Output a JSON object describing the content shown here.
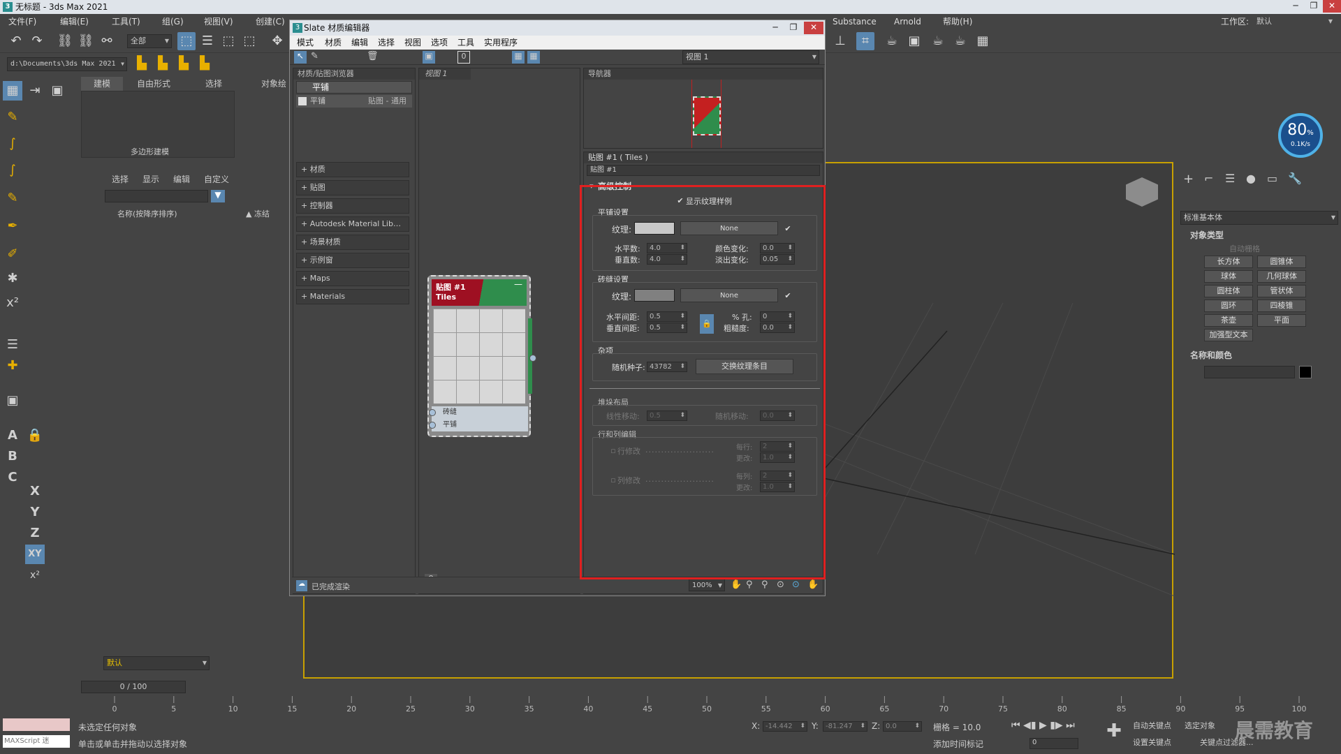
{
  "app": {
    "title": "无标题 - 3ds Max 2021",
    "title_icon": "3"
  },
  "menubar": {
    "items_left": [
      "文件(F)",
      "编辑(E)",
      "工具(T)",
      "组(G)",
      "视图(V)",
      "创建(C)"
    ],
    "items_right": [
      "Substance",
      "Arnold",
      "帮助(H)"
    ],
    "workspace_label": "工作区:",
    "workspace_value": "默认"
  },
  "toolbar": {
    "selection_filter": "全部",
    "path": "d:\\Documents\\3ds Max 2021"
  },
  "ribbon": {
    "tabs": [
      "建模",
      "自由形式",
      "选择",
      "对象绘"
    ],
    "group_label": "多边形建模"
  },
  "scene_explorer": {
    "menu": [
      "选择",
      "显示",
      "编辑",
      "自定义"
    ],
    "column_name": "名称(按降序排序)",
    "column_frozen": "▲ 冻结",
    "layer_label": "默认"
  },
  "slate": {
    "title": "Slate 材质编辑器",
    "menu": [
      "模式",
      "材质",
      "编辑",
      "选择",
      "视图",
      "选项",
      "工具",
      "实用程序"
    ],
    "view_select": "视图 1",
    "browser": {
      "title": "材质/贴图浏览器",
      "search_header": "平铺",
      "result_name": "平铺",
      "result_type": "贴图 - 通用",
      "rollouts": [
        "+ 材质",
        "+ 贴图",
        "+ 控制器",
        "+ Autodesk Material Lib…",
        "+ 场景材质",
        "+ 示例窗",
        "+ Maps",
        "+ Materials"
      ]
    },
    "view_tab": "视图 1",
    "node": {
      "title": "贴图 #1",
      "subtitle": "Tiles",
      "slots": [
        "砖缝",
        "平铺"
      ],
      "collapse": "—"
    },
    "navigator_title": "导航器",
    "param_title": "贴图 #1  ( Tiles )",
    "param_name": "贴图 #1",
    "status": "已完成渲染",
    "zoom": "100%"
  },
  "params": {
    "rollout_title": "高级控制",
    "show_texture_label": "显示纹理样例",
    "tile_setup": {
      "title": "平铺设置",
      "texture_label": "纹理:",
      "none": "None",
      "h_count_label": "水平数:",
      "h_count": "4.0",
      "v_count_label": "垂直数:",
      "v_count": "4.0",
      "color_var_label": "颜色变化:",
      "color_var": "0.0",
      "fade_var_label": "淡出变化:",
      "fade_var": "0.05"
    },
    "grout_setup": {
      "title": "砖缝设置",
      "texture_label": "纹理:",
      "none": "None",
      "h_gap_label": "水平间距:",
      "h_gap": "0.5",
      "v_gap_label": "垂直间距:",
      "v_gap": "0.5",
      "holes_label": "% 孔:",
      "holes": "0",
      "rough_label": "粗糙度:",
      "rough": "0.0"
    },
    "misc": {
      "title": "杂项",
      "seed_label": "随机种子:",
      "seed": "43782",
      "swap_label": "交换纹理条目"
    },
    "stacking": {
      "title": "堆垛布局",
      "line_shift_label": "线性移动:",
      "line_shift": "0.5",
      "random_shift_label": "随机移动:",
      "random_shift": "0.0"
    },
    "row_col": {
      "title": "行和列编辑",
      "row_mod_label": "行修改",
      "per_row_label": "每行:",
      "per_row": "2",
      "change_label": "更改:",
      "row_change": "1.0",
      "col_mod_label": "列修改",
      "per_col_label": "每列:",
      "per_col": "2",
      "col_change": "1.0"
    }
  },
  "cmdpanel": {
    "dropdown": "标准基本体",
    "object_type_title": "对象类型",
    "autogrid": "自动栅格",
    "buttons": [
      "长方体",
      "圆锥体",
      "球体",
      "几何球体",
      "圆柱体",
      "管状体",
      "圆环",
      "四棱锥",
      "茶壶",
      "平面",
      "加强型文本"
    ],
    "name_color_title": "名称和颜色"
  },
  "badge": {
    "percent": "80",
    "unit": "%",
    "speed": "0.1K/s"
  },
  "timeline": {
    "frame": "0 / 100",
    "ticks": [
      "0",
      "5",
      "10",
      "15",
      "20",
      "25",
      "30",
      "35",
      "40",
      "45",
      "50",
      "55",
      "60",
      "65",
      "70",
      "75",
      "80",
      "85",
      "90",
      "95",
      "100"
    ]
  },
  "status": {
    "line1": "未选定任何对象",
    "line2": "单击或单击并拖动以选择对象",
    "maxscript": "MAXScript 迷",
    "x_label": "X:",
    "x": "-14.442",
    "y_label": "Y:",
    "y": "-81.247",
    "z_label": "Z:",
    "z": "0.0",
    "grid": "栅格 = 10.0",
    "add_time_tag": "添加时间标记",
    "auto_key": "自动关键点",
    "set_key": "设置关键点",
    "selected": "选定对象",
    "key_filters": "关键点过滤器...",
    "frame_field": "0",
    "watermark": "晨需教育"
  }
}
